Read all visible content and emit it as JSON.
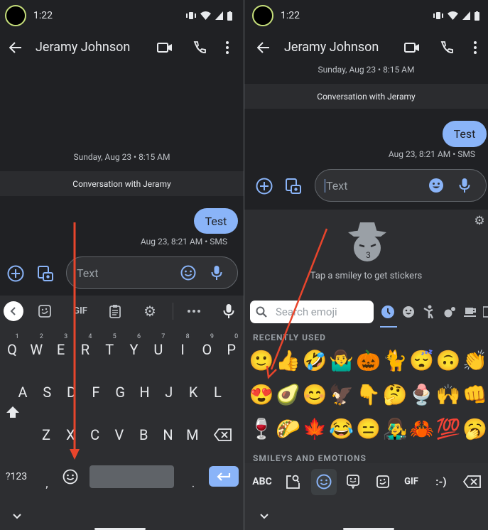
{
  "left": {
    "status": {
      "time": "1:22"
    },
    "appbar": {
      "title": "Jeramy Johnson"
    },
    "date_divider": "Sunday, Aug 23 • 8:15 AM",
    "conversation_banner": "Conversation with Jeramy",
    "message": {
      "text": "Test",
      "meta": "Aug 23, 8:21 AM • SMS"
    },
    "compose": {
      "placeholder": "Text"
    },
    "keyboard": {
      "toolbar": {
        "gif": "GIF"
      },
      "row1": [
        "Q",
        "W",
        "E",
        "R",
        "T",
        "Y",
        "U",
        "I",
        "O",
        "P"
      ],
      "row1_hints": [
        "1",
        "2",
        "3",
        "4",
        "5",
        "6",
        "7",
        "8",
        "9",
        "0"
      ],
      "row2": [
        "A",
        "S",
        "D",
        "F",
        "G",
        "H",
        "J",
        "K",
        "L"
      ],
      "row3": [
        "Z",
        "X",
        "C",
        "V",
        "B",
        "N",
        "M"
      ],
      "symbols": "?123",
      "comma": ",",
      "period": "."
    }
  },
  "right": {
    "status": {
      "time": "1:22"
    },
    "appbar": {
      "title": "Jeramy Johnson"
    },
    "date_divider": "Sunday, Aug 23 • 8:15 AM",
    "conversation_banner": "Conversation with Jeramy",
    "message": {
      "text": "Test",
      "meta": "Aug 23, 8:21 AM • SMS"
    },
    "compose": {
      "placeholder": "Text"
    },
    "stickers": {
      "hint": "Tap a smiley to get stickers"
    },
    "emoji_search": {
      "placeholder": "Search emoji"
    },
    "categories": [
      "recent-icon",
      "smileys-icon",
      "people-icon",
      "animals-icon",
      "food-icon",
      "objects-icon"
    ],
    "recent_label": "RECENTLY USED",
    "recent": [
      [
        "🙂",
        "👍",
        "🤣",
        "🤷‍♂️",
        "🎃",
        "🐈",
        "😴",
        "🙃",
        "👏"
      ],
      [
        "😍",
        "🥑",
        "😊",
        "🦅",
        "👇",
        "🤔",
        "🍨",
        "🙌",
        "👊"
      ],
      [
        "🍷",
        "🌮",
        "🍁",
        "😂",
        "😑",
        "👨‍🎤",
        "🦀",
        "💯",
        "🥱"
      ]
    ],
    "section_label": "SMILEYS AND EMOTIONS",
    "bottom_bar": {
      "abc": "ABC",
      "gif": "GIF",
      "emoticon": ":-)"
    }
  },
  "colors": {
    "accent": "#8ab4f8",
    "arrow": "#e8452c",
    "background": "#202124",
    "keyboard": "#2d2e31"
  }
}
